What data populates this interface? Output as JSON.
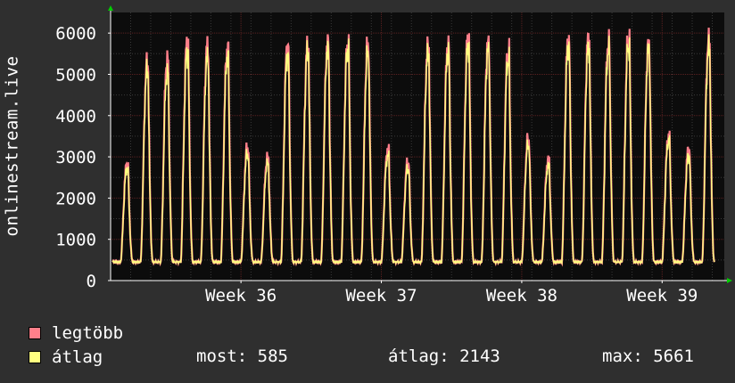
{
  "colors": {
    "background": "#2f2f2f",
    "plot_background": "#0c0c0c",
    "grid_major": "#5a2020",
    "grid_minor": "#3a3a3a",
    "series_max": "#ff7f8a",
    "series_avg": "#ffff80",
    "axis_arrow": "#00cc00"
  },
  "legend": {
    "max_label": "legtöbb",
    "avg_label": "átlag"
  },
  "stats": {
    "now_label": "most:",
    "now_value": "585",
    "avg_label": "átlag:",
    "avg_value": "2143",
    "max_label": "max:",
    "max_value": "5661"
  },
  "chart_data": {
    "type": "area",
    "ylabel": "onlinestream.live",
    "ylim": [
      0,
      6500
    ],
    "yticks": [
      0,
      1000,
      2000,
      3000,
      4000,
      5000,
      6000
    ],
    "x_tick_labels": [
      {
        "label": "Week 36",
        "day": 6.5
      },
      {
        "label": "Week 37",
        "day": 13.5
      },
      {
        "label": "Week 38",
        "day": 20.5
      },
      {
        "label": "Week 39",
        "day": 27.5
      }
    ],
    "xlim_days": [
      0,
      30.6
    ],
    "grid": true,
    "daily_min": 450,
    "daily_peaks": [
      {
        "max": 2800,
        "avg": 2700
      },
      {
        "max": 5200,
        "avg": 5050
      },
      {
        "max": 5300,
        "avg": 5000
      },
      {
        "max": 5750,
        "avg": 5500
      },
      {
        "max": 5600,
        "avg": 5350
      },
      {
        "max": 5550,
        "avg": 5350
      },
      {
        "max": 3200,
        "avg": 3050
      },
      {
        "max": 2950,
        "avg": 2800
      },
      {
        "max": 5650,
        "avg": 5450
      },
      {
        "max": 5600,
        "avg": 5500
      },
      {
        "max": 5700,
        "avg": 5550
      },
      {
        "max": 5650,
        "avg": 5550
      },
      {
        "max": 5650,
        "avg": 5450
      },
      {
        "max": 3150,
        "avg": 3000
      },
      {
        "max": 2850,
        "avg": 2700
      },
      {
        "max": 5600,
        "avg": 5450
      },
      {
        "max": 5650,
        "avg": 5500
      },
      {
        "max": 5800,
        "avg": 5600
      },
      {
        "max": 5700,
        "avg": 5550
      },
      {
        "max": 5500,
        "avg": 5300
      },
      {
        "max": 3400,
        "avg": 3250
      },
      {
        "max": 2900,
        "avg": 2750
      },
      {
        "max": 5750,
        "avg": 5600
      },
      {
        "max": 5800,
        "avg": 5600
      },
      {
        "max": 5700,
        "avg": 5550
      },
      {
        "max": 5850,
        "avg": 5650
      },
      {
        "max": 5650,
        "avg": 5550
      },
      {
        "max": 3450,
        "avg": 3350
      },
      {
        "max": 3150,
        "avg": 3000
      },
      {
        "max": 5750,
        "avg": 5600
      }
    ],
    "series": [
      {
        "name": "legtöbb"
      },
      {
        "name": "átlag"
      }
    ]
  }
}
